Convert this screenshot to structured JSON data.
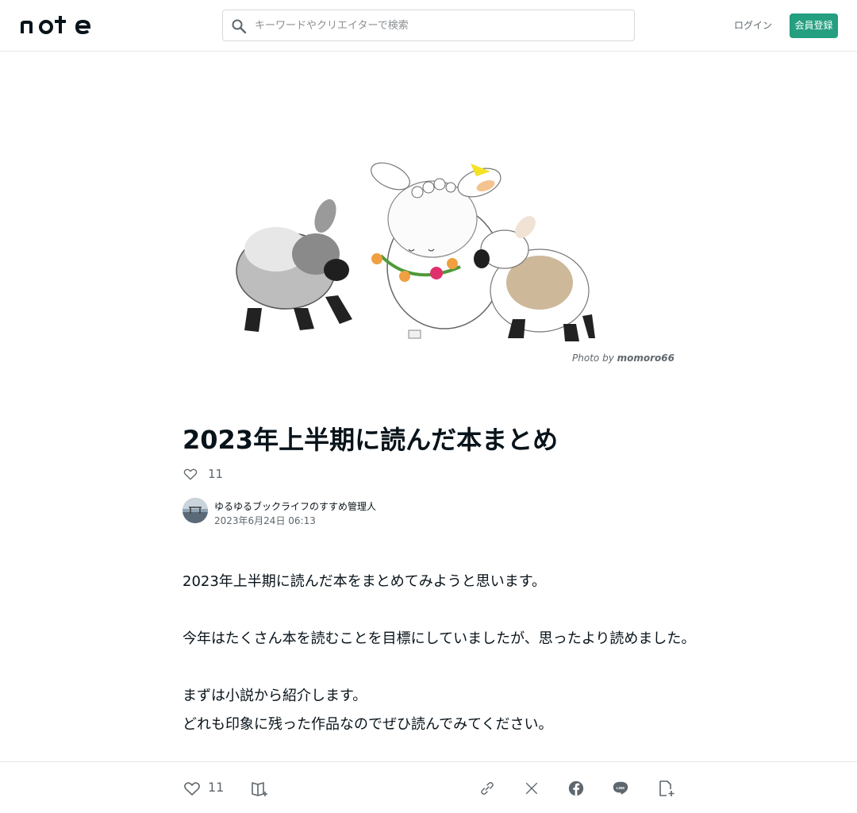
{
  "header": {
    "logo_alt": "note",
    "search_placeholder": "キーワードやクリエイターで検索",
    "login_label": "ログイン",
    "signup_label": "会員登録"
  },
  "hero": {
    "credit_prefix": "Photo by",
    "credit_author": "momoro66"
  },
  "article": {
    "title": "2023年上半期に読んだ本まとめ",
    "likes": "11",
    "author": "ゆるゆるブックライフのすすめ管理人",
    "date": "2023年6月24日 06:13",
    "paragraphs": [
      "2023年上半期に読んだ本をまとめてみようと思います。",
      "今年はたくさん本を読むことを目標にしていましたが、思ったより読めました。",
      "まずは小説から紹介します。",
      "どれも印象に残った作品なのでぜひ読んでみてください。"
    ]
  },
  "bottom_bar": {
    "like_count": "11"
  },
  "colors": {
    "accent": "#249f80",
    "text": "#08131a",
    "muted": "#5e676d",
    "border": "#e6e6e6"
  },
  "icons": [
    "search-icon",
    "heart-icon",
    "magazine-add-icon",
    "link-icon",
    "x-icon",
    "facebook-icon",
    "line-icon",
    "note-add-icon"
  ]
}
